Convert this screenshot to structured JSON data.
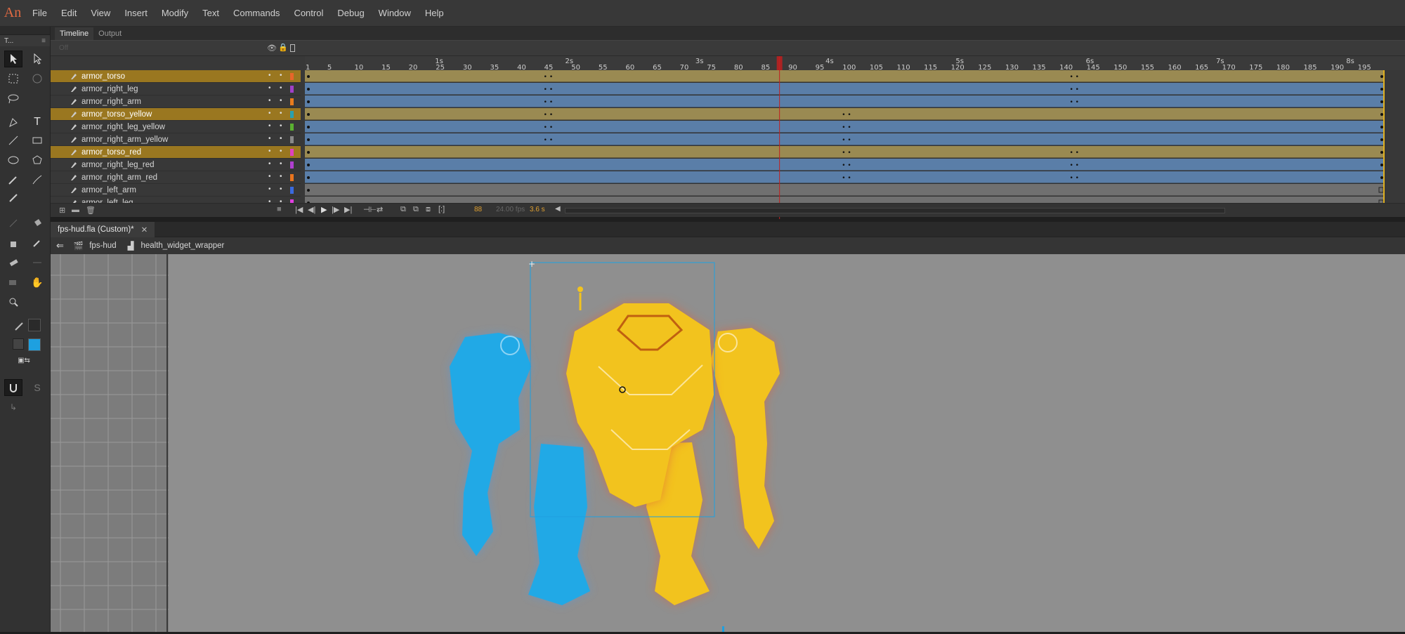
{
  "app": {
    "logo": "An"
  },
  "menu": [
    "File",
    "Edit",
    "View",
    "Insert",
    "Modify",
    "Text",
    "Commands",
    "Control",
    "Debug",
    "Window",
    "Help"
  ],
  "tools_panel": {
    "title": "T..."
  },
  "timeline": {
    "tabs": [
      "Timeline",
      "Output"
    ],
    "off_label": "Off",
    "time_markers": [
      "1s",
      "2s",
      "3s",
      "4s",
      "5s",
      "6s",
      "7s",
      "8s"
    ],
    "frame_numbers": [
      "1",
      "5",
      "10",
      "15",
      "20",
      "25",
      "30",
      "35",
      "40",
      "45",
      "50",
      "55",
      "60",
      "65",
      "70",
      "75",
      "80",
      "85",
      "90",
      "95",
      "100",
      "105",
      "110",
      "115",
      "120",
      "125",
      "130",
      "135",
      "140",
      "145",
      "150",
      "155",
      "160",
      "165",
      "170",
      "175",
      "180",
      "185",
      "190",
      "195"
    ],
    "layers": [
      {
        "name": "armor_torso",
        "highlight": true,
        "color": "#e8662a",
        "keys": [
          45,
          142
        ]
      },
      {
        "name": "armor_right_leg",
        "highlight": false,
        "color": "#a040c8",
        "keys": [
          45,
          142
        ]
      },
      {
        "name": "armor_right_arm",
        "highlight": false,
        "color": "#e87c1e",
        "keys": [
          45,
          142
        ]
      },
      {
        "name": "armor_torso_yellow",
        "highlight": true,
        "color": "#2aa0b0",
        "keys": [
          45,
          100
        ]
      },
      {
        "name": "armor_right_leg_yellow",
        "highlight": false,
        "color": "#5ab030",
        "keys": [
          45,
          100
        ]
      },
      {
        "name": "armor_right_arm_yellow",
        "highlight": false,
        "color": "#888888",
        "keys": [
          45,
          100
        ]
      },
      {
        "name": "armor_torso_red",
        "highlight": true,
        "color": "#e040c0",
        "keys": [
          100,
          142
        ]
      },
      {
        "name": "armor_right_leg_red",
        "highlight": false,
        "color": "#b040d0",
        "keys": [
          100,
          142
        ]
      },
      {
        "name": "armor_right_arm_red",
        "highlight": false,
        "color": "#e8741e",
        "keys": [
          100,
          142
        ]
      },
      {
        "name": "armor_left_arm",
        "highlight": false,
        "color": "#3a6ae0",
        "keys": []
      },
      {
        "name": "armor_left_leg",
        "highlight": false,
        "color": "#e040e0",
        "keys": []
      }
    ],
    "current_frame": "88",
    "fps": "24.00 fps",
    "elapsed": "3.6 s",
    "playhead_frame": 88
  },
  "document": {
    "tab_label": "fps-hud.fla (Custom)*",
    "breadcrumb": [
      "fps-hud",
      "health_widget_wrapper"
    ]
  },
  "colors": {
    "accent": "#1ea0e0",
    "highlight_layer": "#9a7720",
    "playhead": "#c02020",
    "stage": "#8f8f8f"
  }
}
